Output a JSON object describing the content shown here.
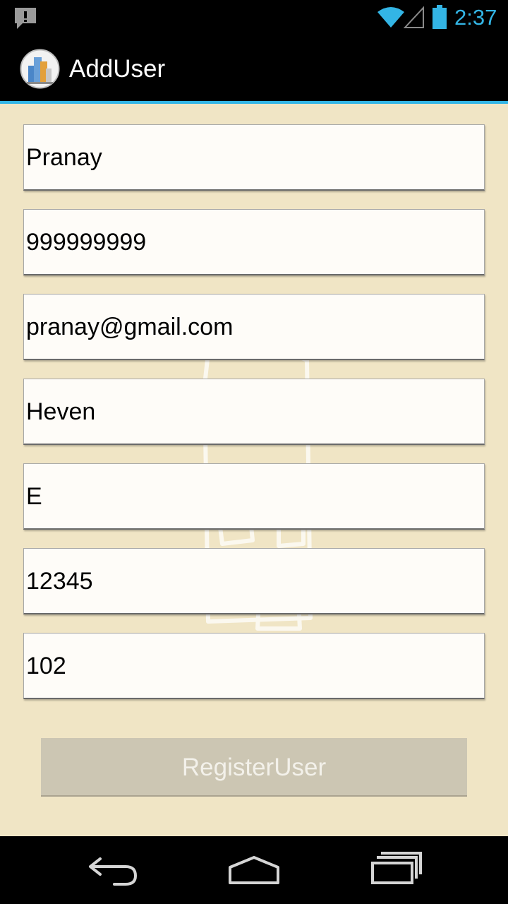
{
  "status_bar": {
    "time": "2:37",
    "icons": [
      "notification-alert-icon",
      "wifi-icon",
      "signal-icon",
      "battery-icon"
    ],
    "accent_color": "#33b5e5"
  },
  "action_bar": {
    "app_icon": "buildings-icon",
    "title": "AddUser"
  },
  "form": {
    "fields": [
      {
        "value": "Pranay"
      },
      {
        "value": "999999999"
      },
      {
        "value": "pranay@gmail.com"
      },
      {
        "value": "Heven"
      },
      {
        "value": "E"
      },
      {
        "value": "12345"
      },
      {
        "value": "102"
      }
    ],
    "submit_label": "RegisterUser"
  },
  "nav_bar": {
    "icons": [
      "back-icon",
      "home-icon",
      "recents-icon"
    ]
  },
  "colors": {
    "background": "#f0e5c5",
    "button_disabled": "#ccc6b3"
  }
}
